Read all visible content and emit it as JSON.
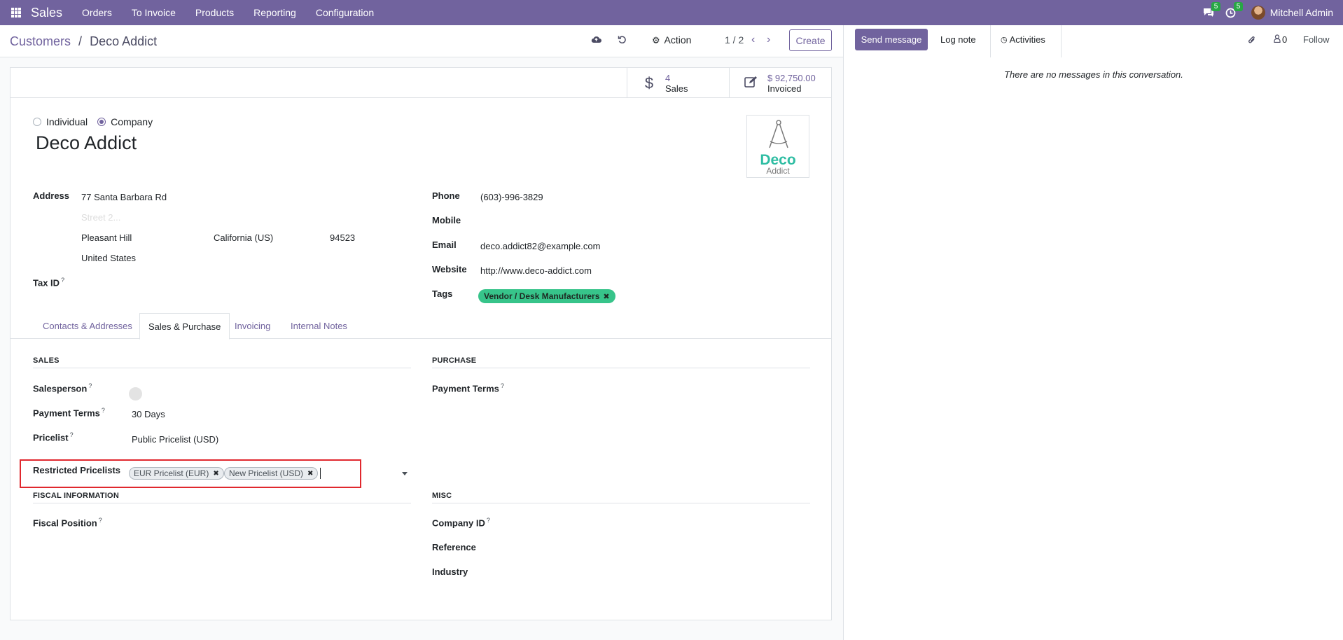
{
  "navbar": {
    "app_name": "Sales",
    "menu": [
      "Orders",
      "To Invoice",
      "Products",
      "Reporting",
      "Configuration"
    ],
    "messages_count": "5",
    "activities_count": "5",
    "user_name": "Mitchell Admin"
  },
  "control_panel": {
    "breadcrumb_parent": "Customers",
    "breadcrumb_separator": "/",
    "breadcrumb_current": "Deco Addict",
    "action_label": "Action",
    "pager": "1 / 2",
    "create_label": "Create"
  },
  "smart_buttons": {
    "sales_value": "4",
    "sales_label": "Sales",
    "invoiced_value": "$ 92,750.00",
    "invoiced_label": "Invoiced"
  },
  "company_type": {
    "individual_label": "Individual",
    "company_label": "Company",
    "selected": "Company"
  },
  "partner": {
    "name": "Deco Addict",
    "logo_text_main": "Deco",
    "logo_text_sub": "Addict",
    "address_label": "Address",
    "street": "77 Santa Barbara Rd",
    "street2_placeholder": "Street 2...",
    "city": "Pleasant Hill",
    "state": "California (US)",
    "zip": "94523",
    "country": "United States",
    "tax_id_label": "Tax ID",
    "phone_label": "Phone",
    "phone": "(603)-996-3829",
    "mobile_label": "Mobile",
    "email_label": "Email",
    "email": "deco.addict82@example.com",
    "website_label": "Website",
    "website": "http://www.deco-addict.com",
    "tags_label": "Tags",
    "tag": "Vendor / Desk Manufacturers",
    "help_mark": "?"
  },
  "tabs": [
    "Contacts & Addresses",
    "Sales & Purchase",
    "Invoicing",
    "Internal Notes"
  ],
  "active_tab": "Sales & Purchase",
  "sales_section": {
    "title": "SALES",
    "salesperson_label": "Salesperson",
    "payment_terms_label": "Payment Terms",
    "payment_terms": "30 Days",
    "pricelist_label": "Pricelist",
    "pricelist": "Public Pricelist (USD)",
    "restricted_pricelists_label": "Restricted Pricelists",
    "restricted_pricelists": [
      "EUR Pricelist (EUR)",
      "New Pricelist (USD)"
    ]
  },
  "purchase_section": {
    "title": "PURCHASE",
    "payment_terms_label": "Payment Terms"
  },
  "fiscal_section": {
    "title": "FISCAL INFORMATION",
    "fiscal_position_label": "Fiscal Position"
  },
  "misc_section": {
    "title": "MISC",
    "company_id_label": "Company ID",
    "reference_label": "Reference",
    "industry_label": "Industry"
  },
  "chatter": {
    "send_message": "Send message",
    "log_note": "Log note",
    "activities": "Activities",
    "followers_count": "0",
    "follow": "Follow",
    "empty_text": "There are no messages in this conversation."
  },
  "colors": {
    "brand": "#71639e",
    "tag_green": "#37c48a",
    "highlight_red": "#e0282e",
    "badge_green": "#28a745"
  }
}
